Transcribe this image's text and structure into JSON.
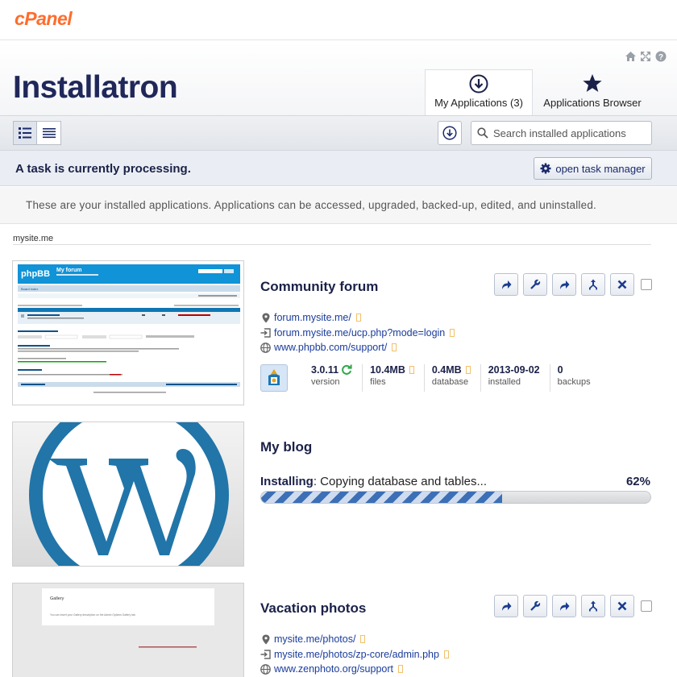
{
  "topbar": {
    "logo": "cPanel"
  },
  "header": {
    "brand": "Installatron",
    "tabs": [
      {
        "label": "My Applications (3)",
        "icon": "download-circle-icon",
        "active": true
      },
      {
        "label": "Applications Browser",
        "icon": "star-icon",
        "active": false
      }
    ],
    "top_icons": [
      "home-icon",
      "fullscreen-icon",
      "help-icon"
    ]
  },
  "toolbar": {
    "views": [
      "list-detail-view",
      "list-compact-view"
    ],
    "search_placeholder": "Search installed applications"
  },
  "task": {
    "message": "A task is currently processing.",
    "button_label": "open task manager"
  },
  "info": "These are your installed applications. Applications can be accessed, upgraded, backed-up, edited, and uninstalled.",
  "domain": "mysite.me",
  "apps": [
    {
      "title": "Community forum",
      "links": [
        "forum.mysite.me/",
        "forum.mysite.me/ucp.php?mode=login",
        "www.phpbb.com/support/"
      ],
      "stats": [
        {
          "value": "3.0.11",
          "label": "version"
        },
        {
          "value": "10.4MB",
          "label": "files"
        },
        {
          "value": "0.4MB",
          "label": "database"
        },
        {
          "value": "2013-09-02",
          "label": "installed"
        },
        {
          "value": "0",
          "label": "backups"
        }
      ],
      "thumb": {
        "logo": "phpBB",
        "title": "My forum",
        "text": "Board index"
      }
    },
    {
      "title": "My blog",
      "progress": {
        "status": "Installing",
        "message": ": Copying database and tables...",
        "percent_label": "62%",
        "percent": 62
      }
    },
    {
      "title": "Vacation photos",
      "links": [
        "mysite.me/photos/",
        "mysite.me/photos/zp-core/admin.php",
        "www.zenphoto.org/support"
      ],
      "thumb": {
        "title": "Gallery",
        "text": "You can insert your Gallery description on the Admin Options Gallery tab."
      }
    }
  ],
  "colors": {
    "brand": "#20285a",
    "accent": "#ff6c2c",
    "link": "#1a3c9c",
    "progress": "#3c6fb6"
  }
}
